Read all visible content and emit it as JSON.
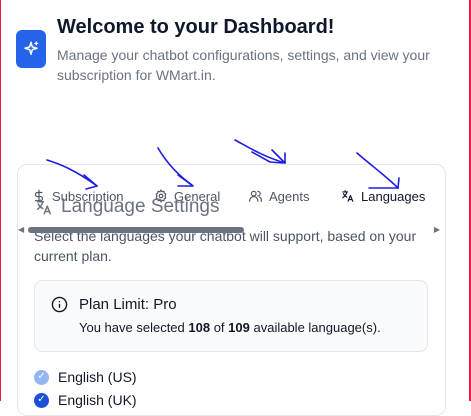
{
  "header": {
    "title": "Welcome to your Dashboard!",
    "subtitle": "Manage your chatbot configurations, settings, and view your subscription for WMart.in.",
    "logo_icon": "sparkles-icon"
  },
  "tabs": [
    {
      "label": "Subscription",
      "icon": "dollar-icon"
    },
    {
      "label": "General",
      "icon": "gear-icon"
    },
    {
      "label": "Agents",
      "icon": "users-icon"
    },
    {
      "label": "Languages",
      "icon": "translate-icon",
      "active": true
    }
  ],
  "languages_section": {
    "heading": "Language Settings",
    "description": "Select the languages your chatbot will support, based on your current plan.",
    "plan": {
      "title": "Plan Limit: Pro",
      "text_before": "You have selected ",
      "selected": "108",
      "text_middle": " of ",
      "available": "109",
      "text_after": " available language(s)."
    },
    "languages": [
      {
        "name": "English (US)",
        "checked": true
      },
      {
        "name": "English (UK)",
        "checked": true
      }
    ]
  },
  "colors": {
    "accent": "#2563eb",
    "border_frame": "#e11d48",
    "annotation_ink": "#1d1de0"
  }
}
